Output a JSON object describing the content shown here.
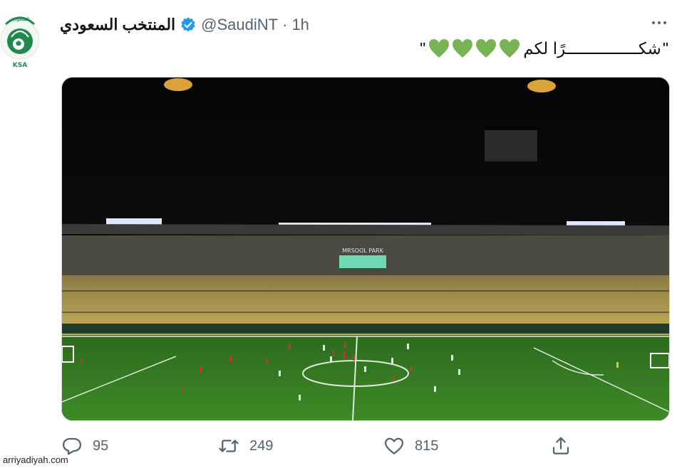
{
  "tweet": {
    "display_name": "المنتخب السعودي",
    "handle": "@SaudiNT",
    "separator": "·",
    "time": "1h",
    "text_open_quote": "\"",
    "text_word": "شكـــــــــــــــرًا لكم",
    "text_close_quote": "\"",
    "hearts_count": 4,
    "heart_color": "#77b255",
    "verified_color": "#1d9bf0"
  },
  "avatar": {
    "arabic_text": "السعودية",
    "caption": "KSA",
    "color": "#1f8a4c"
  },
  "media": {
    "stadium_sign": "MRSOOL PARK"
  },
  "actions": {
    "replies": "95",
    "retweets": "249",
    "likes": "815"
  },
  "watermark": "arriyadiyah.com",
  "icons": [
    "verified-icon",
    "more-icon",
    "heart-icon",
    "reply-icon",
    "retweet-icon",
    "like-icon",
    "share-icon"
  ]
}
